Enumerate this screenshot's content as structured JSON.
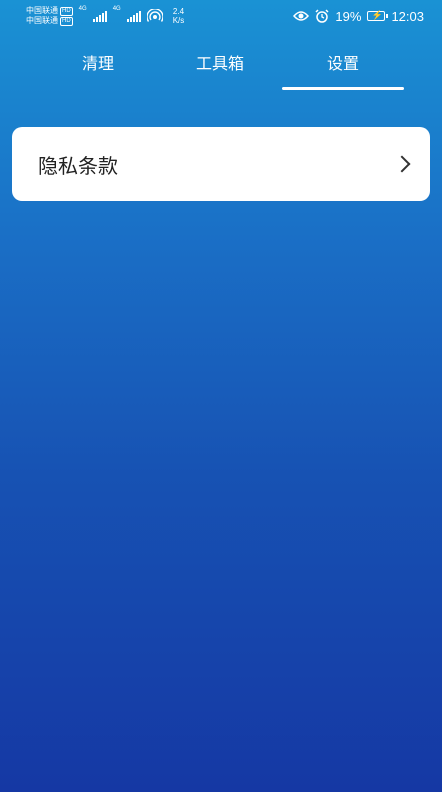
{
  "status_bar": {
    "carrier1": "中国联通",
    "carrier2": "中国联通",
    "hd": "HD",
    "net1": "4G",
    "net2": "4G",
    "speed_value": "2.4",
    "speed_unit": "K/s",
    "battery_percent": "19%",
    "time": "12:03"
  },
  "tabs": [
    {
      "label": "清理"
    },
    {
      "label": "工具箱"
    },
    {
      "label": "设置"
    }
  ],
  "active_tab": "设置",
  "settings": {
    "items": [
      {
        "label": "隐私条款"
      }
    ]
  },
  "colors": {
    "background_top": "#1a92d4",
    "background_bottom": "#1538a4",
    "card": "#ffffff"
  }
}
